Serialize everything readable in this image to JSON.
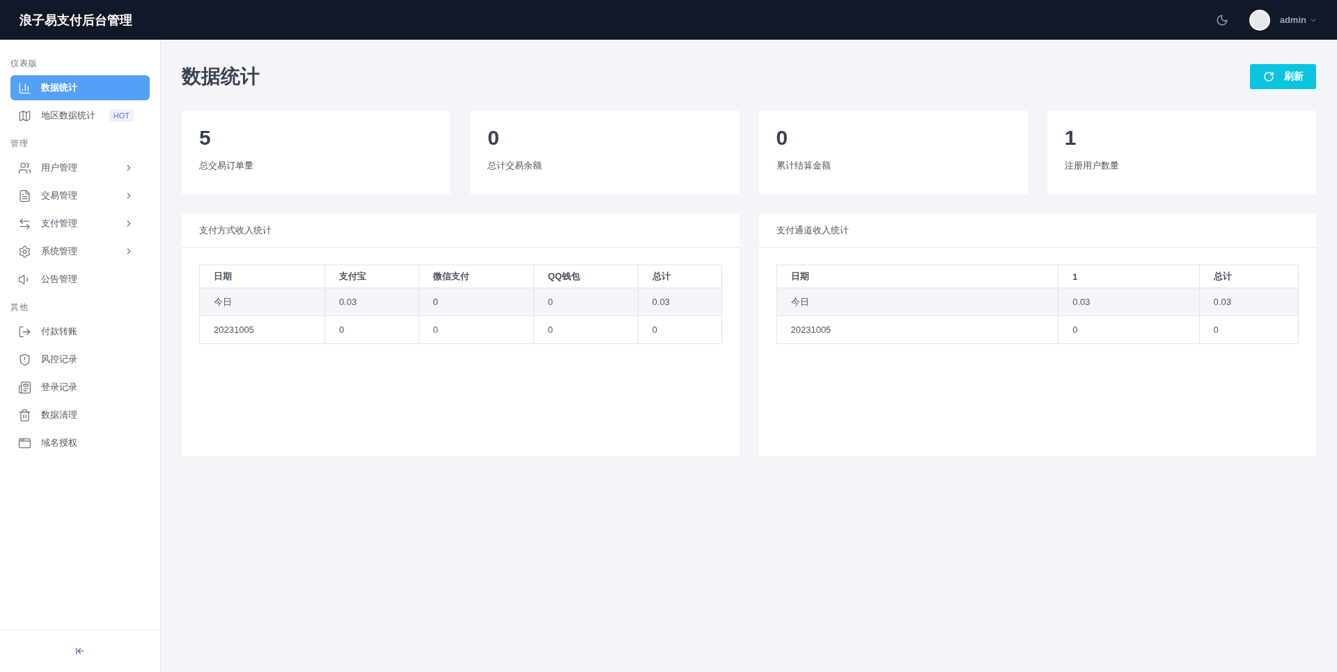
{
  "header": {
    "title": "浪子易支付后台管理",
    "user": "admin"
  },
  "sidebar": {
    "sections": [
      {
        "label": "仪表版",
        "items": [
          {
            "label": "数据统计",
            "selected": true,
            "expandable": false
          },
          {
            "label": "地区数据统计",
            "selected": false,
            "expandable": false,
            "badge": "HOT"
          }
        ]
      },
      {
        "label": "管理",
        "items": [
          {
            "label": "用户管理",
            "selected": false,
            "expandable": true
          },
          {
            "label": "交易管理",
            "selected": false,
            "expandable": true
          },
          {
            "label": "支付管理",
            "selected": false,
            "expandable": true
          },
          {
            "label": "系统管理",
            "selected": false,
            "expandable": true
          },
          {
            "label": "公告管理",
            "selected": false,
            "expandable": false
          }
        ]
      },
      {
        "label": "其他",
        "items": [
          {
            "label": "付款转账",
            "selected": false,
            "expandable": false
          },
          {
            "label": "风控记录",
            "selected": false,
            "expandable": false
          },
          {
            "label": "登录记录",
            "selected": false,
            "expandable": false
          },
          {
            "label": "数据清理",
            "selected": false,
            "expandable": false
          },
          {
            "label": "域名授权",
            "selected": false,
            "expandable": false
          }
        ]
      }
    ]
  },
  "page": {
    "title": "数据统计",
    "refresh_button": "刷新"
  },
  "stats": [
    {
      "value": "5",
      "label": "总交易订单量"
    },
    {
      "value": "0",
      "label": "总计交易余额"
    },
    {
      "value": "0",
      "label": "累计结算金额"
    },
    {
      "value": "1",
      "label": "注册用户数量"
    }
  ],
  "panels": [
    {
      "title": "支付方式收入统计",
      "table": {
        "columns": [
          "日期",
          "支付宝",
          "微信支付",
          "QQ钱包",
          "总计"
        ],
        "rows": [
          [
            "今日",
            "0.03",
            "0",
            "0",
            "0.03"
          ],
          [
            "20231005",
            "0",
            "0",
            "0",
            "0"
          ]
        ]
      }
    },
    {
      "title": "支付通道收入统计",
      "table": {
        "columns": [
          "日期",
          "1",
          "总计"
        ],
        "rows": [
          [
            "今日",
            "0.03",
            "0.03"
          ],
          [
            "20231005",
            "0",
            "0"
          ]
        ]
      }
    }
  ]
}
